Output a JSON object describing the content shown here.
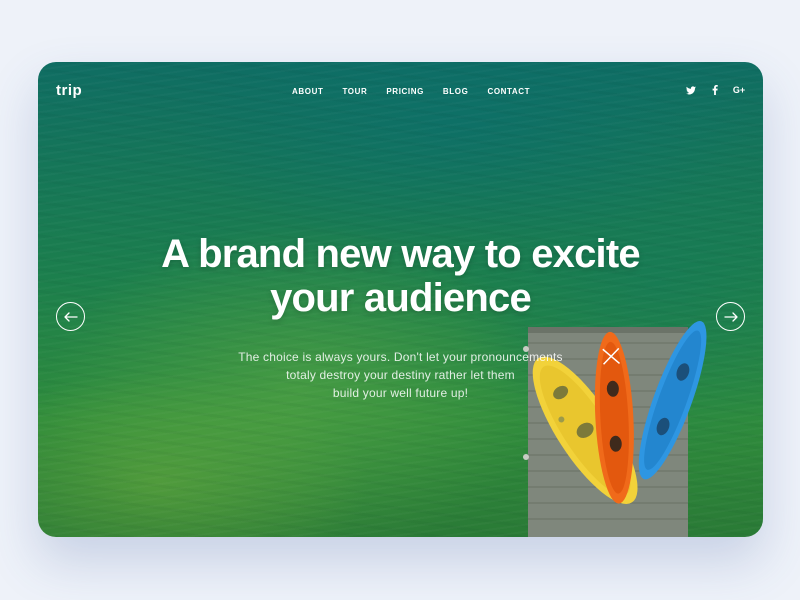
{
  "brand": {
    "logo": "trip"
  },
  "nav": {
    "items": [
      "ABOUT",
      "TOUR",
      "PRICING",
      "BLOG",
      "CONTACT"
    ]
  },
  "social": {
    "icons": [
      "twitter-icon",
      "facebook-icon",
      "google-plus-icon"
    ],
    "google_plus_label": "G+"
  },
  "hero": {
    "title_line1": "A brand new way to excite",
    "title_line2": "your audience",
    "subtitle_line1": "The choice is always yours. Don't let your pronouncements",
    "subtitle_line2": "totaly destroy your destiny rather let them",
    "subtitle_line3": "build your well future up!"
  },
  "slider": {
    "prev_icon": "arrow-left-icon",
    "next_icon": "arrow-right-icon"
  },
  "colors": {
    "background": "#eef2f9",
    "water_dark": "#0f6d63",
    "water_light": "#2f8c3c",
    "kayak_yellow": "#f2d23a",
    "kayak_orange": "#f06a1a",
    "kayak_blue": "#2e96e2",
    "dock_wood": "#8c9488"
  }
}
